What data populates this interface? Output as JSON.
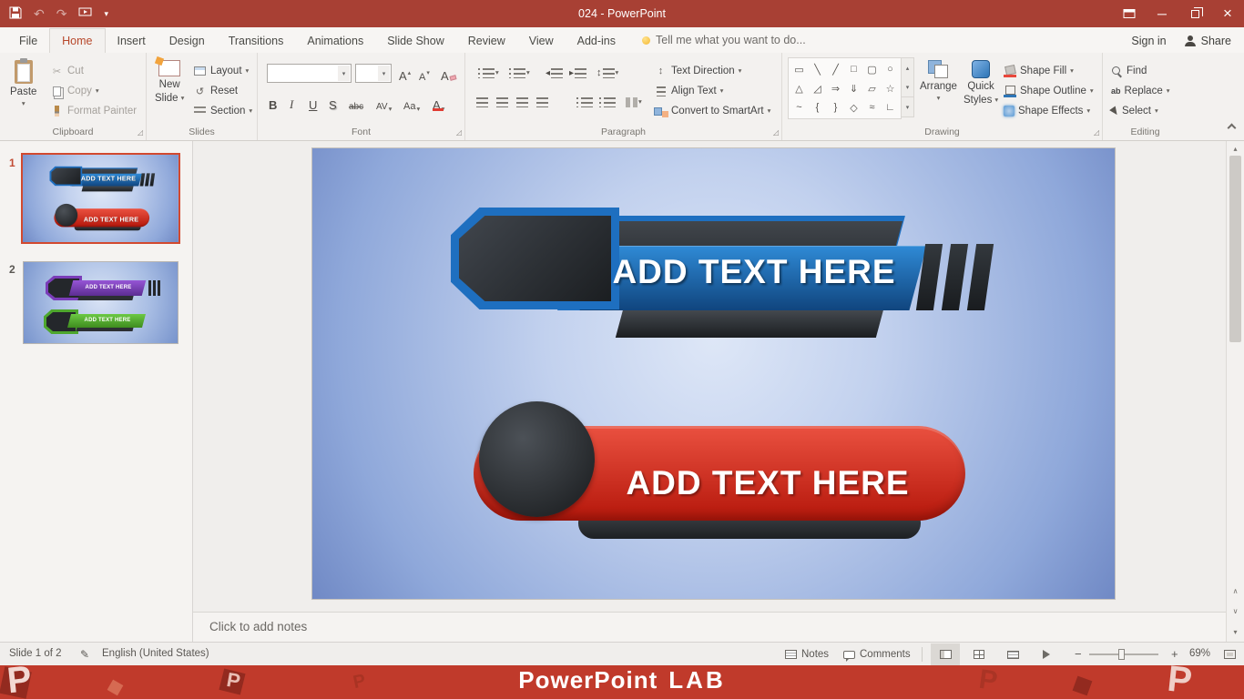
{
  "titlebar": {
    "title": "024 - PowerPoint"
  },
  "tabs": [
    {
      "label": "File"
    },
    {
      "label": "Home"
    },
    {
      "label": "Insert"
    },
    {
      "label": "Design"
    },
    {
      "label": "Transitions"
    },
    {
      "label": "Animations"
    },
    {
      "label": "Slide Show"
    },
    {
      "label": "Review"
    },
    {
      "label": "View"
    },
    {
      "label": "Add-ins"
    }
  ],
  "tell_me": "Tell me what you want to do...",
  "account": {
    "sign_in": "Sign in",
    "share": "Share"
  },
  "ribbon": {
    "clipboard": {
      "label": "Clipboard",
      "paste": "Paste",
      "cut": "Cut",
      "copy": "Copy",
      "format_painter": "Format Painter"
    },
    "slides": {
      "label": "Slides",
      "new_line1": "New",
      "new_line2": "Slide",
      "layout": "Layout",
      "reset": "Reset",
      "section": "Section"
    },
    "font": {
      "label": "Font",
      "bold": "B",
      "italic": "I",
      "underline": "U",
      "shadow": "S",
      "strike": "abc",
      "spacing": "AV",
      "case": "Aa",
      "color": "A",
      "size_letter": "A"
    },
    "paragraph": {
      "label": "Paragraph",
      "text_direction": "Text Direction",
      "align_text": "Align Text",
      "smartart": "Convert to SmartArt"
    },
    "drawing": {
      "label": "Drawing",
      "arrange": "Arrange",
      "quick_line1": "Quick",
      "quick_line2": "Styles",
      "shape_fill": "Shape Fill",
      "shape_outline": "Shape Outline",
      "shape_effects": "Shape Effects"
    },
    "editing": {
      "label": "Editing",
      "find": "Find",
      "replace": "Replace",
      "select": "Select",
      "replace_icon": "ab"
    }
  },
  "icons": {
    "dropdown": "▾",
    "launcher": "◿",
    "undo": "↶",
    "redo": "↷",
    "minimize": "─",
    "close": "×",
    "reset_slide": "↺",
    "cut": "✂",
    "spell": "✎",
    "grow": "▴",
    "shrink": "▾",
    "scroll_up": "▴",
    "scroll_down": "▾",
    "line_spacing": "↕",
    "text_direction": "↕",
    "prev_chevron": "∧",
    "next_chevron": "∨",
    "shapes_row1": [
      "▭",
      "╲",
      "╱",
      "□",
      "▢",
      "○"
    ],
    "shapes_row2": [
      "△",
      "◿",
      "⇒",
      "⇓",
      "▱",
      "☆"
    ],
    "shapes_row3": [
      "~",
      "{",
      "}",
      "◇",
      "≈",
      "∟"
    ],
    "zoom_minus": "−",
    "zoom_plus": "+"
  },
  "slides_panel": {
    "slide1_number": "1",
    "slide2_number": "2"
  },
  "slide": {
    "banner_top_text": "ADD TEXT HERE",
    "banner_bottom_text": "ADD TEXT HERE"
  },
  "thumb2": {
    "top_text": "ADD TEXT HERE",
    "bottom_text": "ADD TEXT HERE"
  },
  "notes": {
    "placeholder": "Click to add notes"
  },
  "statusbar": {
    "slide_indicator": "Slide 1 of 2",
    "language": "English (United States)",
    "notes_btn": "Notes",
    "comments_btn": "Comments",
    "zoom_level": "69%"
  },
  "footer": {
    "brand": "PowerPoint",
    "brand_bold": "LAB",
    "decor_letter": "P"
  },
  "colors": {
    "titlebar": "#A84034",
    "accent": "#B7472A",
    "footer": "#C03A2B",
    "banner_blue": "#1E6FC0",
    "banner_red": "#D2251A",
    "thumb2_purple": "#7A3DB8",
    "thumb2_green": "#4EA72E"
  }
}
